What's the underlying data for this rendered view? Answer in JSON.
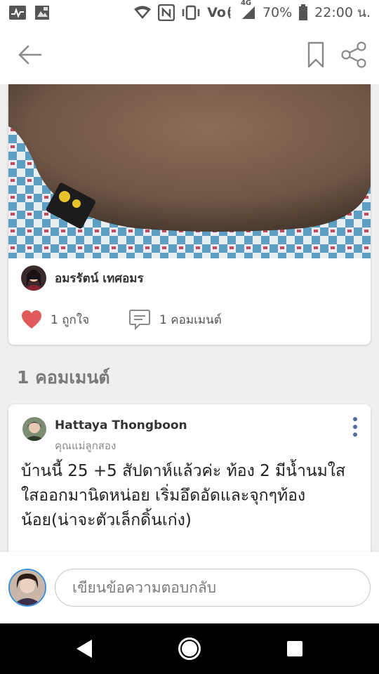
{
  "status_bar": {
    "battery": "70%",
    "time": "22:00 น.",
    "network": "4G",
    "volte_label": "Vo",
    "icons": [
      "activity-icon",
      "gallery-icon",
      "wifi-icon",
      "nfc-icon",
      "vibrate-icon",
      "volte-icon",
      "signal-icon",
      "battery-icon"
    ]
  },
  "app_bar": {
    "icons": [
      "back-arrow-icon",
      "bookmark-icon",
      "share-icon"
    ]
  },
  "post": {
    "author_name": "อมรรัตน์ เทศอมร",
    "like_label": "1 ถูกใจ",
    "comment_label": "1 คอมเมนต์"
  },
  "comments": {
    "heading": "1 คอมเมนต์",
    "items": [
      {
        "name": "Hattaya Thongboon",
        "subtitle": "คุณแม่ลูกสอง",
        "text": "บ้านนี้ 25 +5 สัปดาห์แล้วค่ะ ท้อง 2  มีน้ำนมใสใสออกมานิดหน่อย เริ่มอึดอัดและจุกๆท้องน้อย(น่าจะตัวเล็กดิ้นเก่ง)"
      }
    ]
  },
  "reply": {
    "placeholder": "เขียนข้อความตอบกลับ"
  },
  "colors": {
    "heart": "#e05a5a",
    "accent": "#4f6ea0",
    "icon_gray": "#8a8a8a"
  }
}
